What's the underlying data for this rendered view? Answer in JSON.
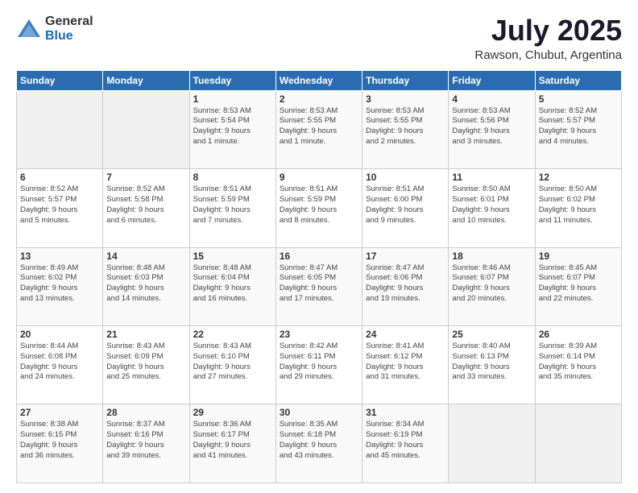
{
  "header": {
    "logo_general": "General",
    "logo_blue": "Blue",
    "month": "July 2025",
    "location": "Rawson, Chubut, Argentina"
  },
  "weekdays": [
    "Sunday",
    "Monday",
    "Tuesday",
    "Wednesday",
    "Thursday",
    "Friday",
    "Saturday"
  ],
  "weeks": [
    [
      {
        "day": "",
        "info": ""
      },
      {
        "day": "",
        "info": ""
      },
      {
        "day": "1",
        "info": "Sunrise: 8:53 AM\nSunset: 5:54 PM\nDaylight: 9 hours\nand 1 minute."
      },
      {
        "day": "2",
        "info": "Sunrise: 8:53 AM\nSunset: 5:55 PM\nDaylight: 9 hours\nand 1 minute."
      },
      {
        "day": "3",
        "info": "Sunrise: 8:53 AM\nSunset: 5:55 PM\nDaylight: 9 hours\nand 2 minutes."
      },
      {
        "day": "4",
        "info": "Sunrise: 8:53 AM\nSunset: 5:56 PM\nDaylight: 9 hours\nand 3 minutes."
      },
      {
        "day": "5",
        "info": "Sunrise: 8:52 AM\nSunset: 5:57 PM\nDaylight: 9 hours\nand 4 minutes."
      }
    ],
    [
      {
        "day": "6",
        "info": "Sunrise: 8:52 AM\nSunset: 5:57 PM\nDaylight: 9 hours\nand 5 minutes."
      },
      {
        "day": "7",
        "info": "Sunrise: 8:52 AM\nSunset: 5:58 PM\nDaylight: 9 hours\nand 6 minutes."
      },
      {
        "day": "8",
        "info": "Sunrise: 8:51 AM\nSunset: 5:59 PM\nDaylight: 9 hours\nand 7 minutes."
      },
      {
        "day": "9",
        "info": "Sunrise: 8:51 AM\nSunset: 5:59 PM\nDaylight: 9 hours\nand 8 minutes."
      },
      {
        "day": "10",
        "info": "Sunrise: 8:51 AM\nSunset: 6:00 PM\nDaylight: 9 hours\nand 9 minutes."
      },
      {
        "day": "11",
        "info": "Sunrise: 8:50 AM\nSunset: 6:01 PM\nDaylight: 9 hours\nand 10 minutes."
      },
      {
        "day": "12",
        "info": "Sunrise: 8:50 AM\nSunset: 6:02 PM\nDaylight: 9 hours\nand 11 minutes."
      }
    ],
    [
      {
        "day": "13",
        "info": "Sunrise: 8:49 AM\nSunset: 6:02 PM\nDaylight: 9 hours\nand 13 minutes."
      },
      {
        "day": "14",
        "info": "Sunrise: 8:48 AM\nSunset: 6:03 PM\nDaylight: 9 hours\nand 14 minutes."
      },
      {
        "day": "15",
        "info": "Sunrise: 8:48 AM\nSunset: 6:04 PM\nDaylight: 9 hours\nand 16 minutes."
      },
      {
        "day": "16",
        "info": "Sunrise: 8:47 AM\nSunset: 6:05 PM\nDaylight: 9 hours\nand 17 minutes."
      },
      {
        "day": "17",
        "info": "Sunrise: 8:47 AM\nSunset: 6:06 PM\nDaylight: 9 hours\nand 19 minutes."
      },
      {
        "day": "18",
        "info": "Sunrise: 8:46 AM\nSunset: 6:07 PM\nDaylight: 9 hours\nand 20 minutes."
      },
      {
        "day": "19",
        "info": "Sunrise: 8:45 AM\nSunset: 6:07 PM\nDaylight: 9 hours\nand 22 minutes."
      }
    ],
    [
      {
        "day": "20",
        "info": "Sunrise: 8:44 AM\nSunset: 6:08 PM\nDaylight: 9 hours\nand 24 minutes."
      },
      {
        "day": "21",
        "info": "Sunrise: 8:43 AM\nSunset: 6:09 PM\nDaylight: 9 hours\nand 25 minutes."
      },
      {
        "day": "22",
        "info": "Sunrise: 8:43 AM\nSunset: 6:10 PM\nDaylight: 9 hours\nand 27 minutes."
      },
      {
        "day": "23",
        "info": "Sunrise: 8:42 AM\nSunset: 6:11 PM\nDaylight: 9 hours\nand 29 minutes."
      },
      {
        "day": "24",
        "info": "Sunrise: 8:41 AM\nSunset: 6:12 PM\nDaylight: 9 hours\nand 31 minutes."
      },
      {
        "day": "25",
        "info": "Sunrise: 8:40 AM\nSunset: 6:13 PM\nDaylight: 9 hours\nand 33 minutes."
      },
      {
        "day": "26",
        "info": "Sunrise: 8:39 AM\nSunset: 6:14 PM\nDaylight: 9 hours\nand 35 minutes."
      }
    ],
    [
      {
        "day": "27",
        "info": "Sunrise: 8:38 AM\nSunset: 6:15 PM\nDaylight: 9 hours\nand 36 minutes."
      },
      {
        "day": "28",
        "info": "Sunrise: 8:37 AM\nSunset: 6:16 PM\nDaylight: 9 hours\nand 39 minutes."
      },
      {
        "day": "29",
        "info": "Sunrise: 8:36 AM\nSunset: 6:17 PM\nDaylight: 9 hours\nand 41 minutes."
      },
      {
        "day": "30",
        "info": "Sunrise: 8:35 AM\nSunset: 6:18 PM\nDaylight: 9 hours\nand 43 minutes."
      },
      {
        "day": "31",
        "info": "Sunrise: 8:34 AM\nSunset: 6:19 PM\nDaylight: 9 hours\nand 45 minutes."
      },
      {
        "day": "",
        "info": ""
      },
      {
        "day": "",
        "info": ""
      }
    ]
  ]
}
